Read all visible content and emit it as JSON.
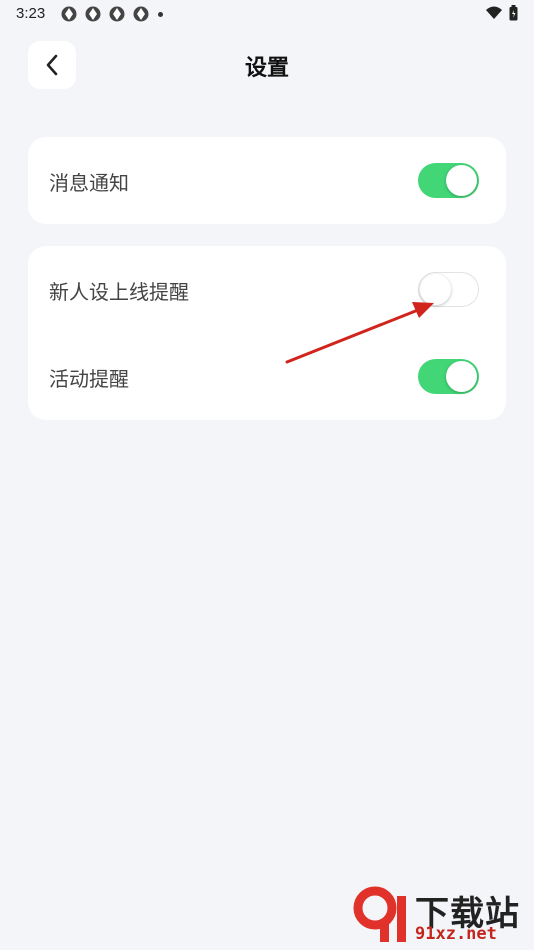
{
  "status_bar": {
    "time": "3:23"
  },
  "header": {
    "title": "设置"
  },
  "settings": {
    "notification": {
      "label": "消息通知",
      "enabled": true
    },
    "new_user_online": {
      "label": "新人设上线提醒",
      "enabled": false
    },
    "activity_reminder": {
      "label": "活动提醒",
      "enabled": true
    }
  },
  "colors": {
    "toggle_on": "#42d676",
    "background": "#f4f5f9",
    "annotation_arrow": "#d0241c"
  },
  "watermark": {
    "brand_cn": "下载站",
    "domain": "91xz.net"
  }
}
